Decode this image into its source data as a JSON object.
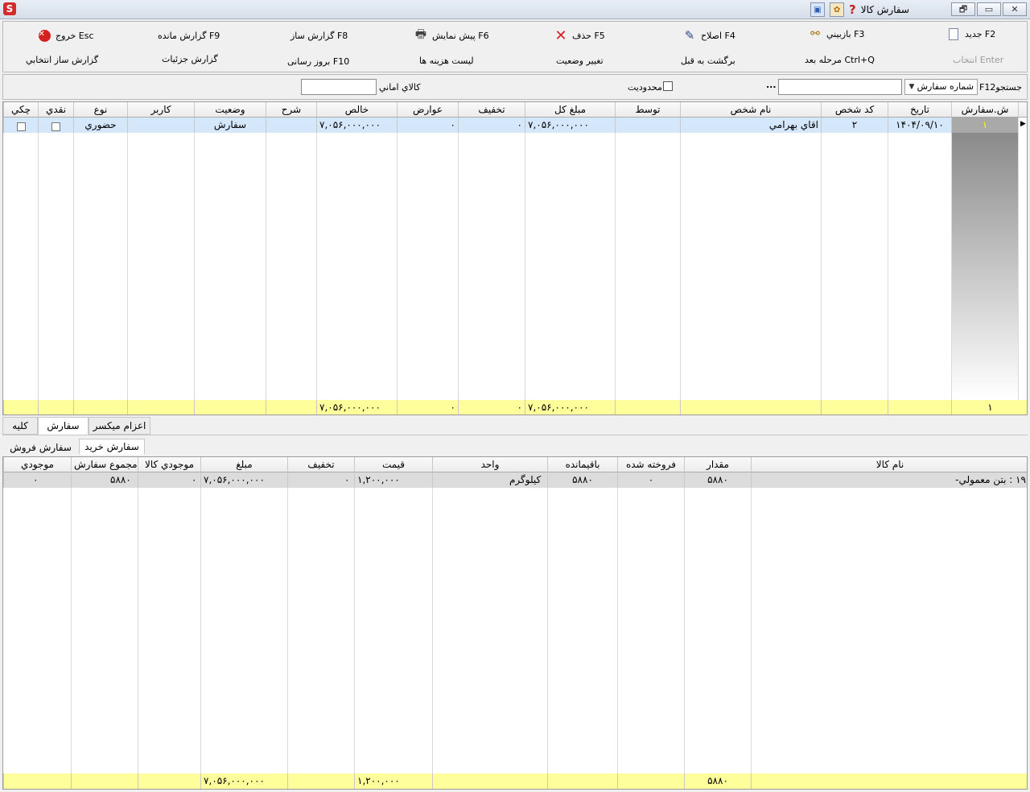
{
  "window": {
    "title": "سفارش كالا",
    "app_icon": "S",
    "controls": [
      "🗗",
      "▭",
      "✕"
    ]
  },
  "toolbar": {
    "row1": {
      "new": "جديد F2",
      "inspect": "بازبيني F3",
      "edit": "اصلاح F4",
      "delete": "حذف F5",
      "preview": "پيش نمايش F6",
      "report_builder": "گزارش ساز F8",
      "remaining_report": "گزارش مانده F9",
      "exit": "خروج Esc"
    },
    "row2": {
      "select": "انتخاب Enter",
      "next_step": "مرحله بعد Ctrl+Q",
      "back_prev": "برگشت به قبل",
      "change_status": "تغيير وضعيت",
      "cost_list": "ليست هزينه ها",
      "update": "بروز رسانی F10",
      "detail_report": "گزارش جزئيات",
      "selective_report": "گزارش ساز انتخابي"
    }
  },
  "search": {
    "label": "F12جستجو",
    "field_selected": "شماره سفارش",
    "value": "",
    "browse": "...",
    "limit_label": "محدوديت",
    "consignment_label": "كالاي اماني",
    "consignment_value": ""
  },
  "orders": {
    "columns": [
      "ش.سفارش",
      "تاريخ",
      "كد شخص",
      "نام شخص",
      "توسط",
      "مبلغ كل",
      "تخفيف",
      "عوارض",
      "خالص",
      "شرح",
      "وضعيت",
      "كاربر",
      "نوع",
      "نقدي",
      "چكي"
    ],
    "rows": [
      {
        "no": "۱",
        "date": "۱۴۰۴/۰۹/۱۰",
        "person_code": "۲",
        "person_name": "اقاي بهرامي",
        "by": "",
        "total": "۷,۰۵۶,۰۰۰,۰۰۰",
        "discount": "۰",
        "tax": "۰",
        "net": "۷,۰۵۶,۰۰۰,۰۰۰",
        "desc": "",
        "status": "سفارش",
        "user": "",
        "type": "حضوري",
        "cash": false,
        "cheque": false
      }
    ],
    "totals": {
      "no": "۱",
      "total": "۷,۰۵۶,۰۰۰,۰۰۰",
      "discount": "۰",
      "tax": "۰",
      "net": "۷,۰۵۶,۰۰۰,۰۰۰"
    }
  },
  "tabs1": [
    "كليه",
    "سفارش",
    "اعزام ميكسر"
  ],
  "tabs1_active": "سفارش",
  "tabs2": [
    "سفارش خريد",
    "سفارش فروش"
  ],
  "items": {
    "columns": [
      "نام كالا",
      "مقدار",
      "فروخته شده",
      "باقيمانده",
      "واحد",
      "قيمت",
      "تخفيف",
      "مبلغ",
      "موجودي كالا",
      "مجموع سفارش",
      "موجودي"
    ],
    "rows": [
      {
        "name": "۱۹ : بتن معمولي-",
        "qty": "۵۸۸۰",
        "sold": "۰",
        "remaining": "۵۸۸۰",
        "unit": "كيلوگرم",
        "price": "۱,۲۰۰,۰۰۰",
        "discount": "۰",
        "amount": "۷,۰۵۶,۰۰۰,۰۰۰",
        "stock": "۰",
        "order_sum": "۵۸۸۰",
        "inventory": "۰"
      }
    ],
    "totals": {
      "qty": "۵۸۸۰",
      "price": "۱,۲۰۰,۰۰۰",
      "amount": "۷,۰۵۶,۰۰۰,۰۰۰"
    }
  }
}
